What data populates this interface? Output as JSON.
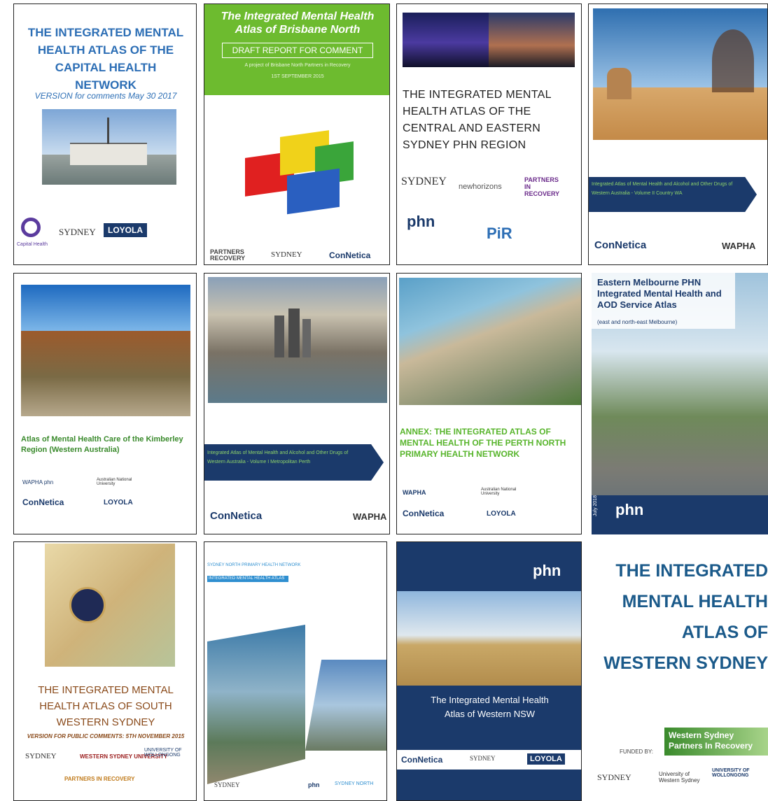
{
  "covers": [
    {
      "title": "THE INTEGRATED MENTAL HEALTH ATLAS OF THE CAPITAL HEALTH NETWORK",
      "subtitle": "VERSION for comments May 30 2017",
      "logos": [
        "Capital Health",
        "SYDNEY",
        "LOYOLA"
      ]
    },
    {
      "title": "The Integrated Mental Health Atlas of Brisbane North",
      "banner": "DRAFT REPORT FOR COMMENT",
      "subtitle": "A project of Brisbane North Partners in Recovery",
      "date": "1ST SEPTEMBER 2015",
      "logos": [
        "PARTNERS RECOVERY",
        "SYDNEY",
        "ConNetica"
      ]
    },
    {
      "title": "THE INTEGRATED MENTAL HEALTH ATLAS OF THE CENTRAL AND EASTERN SYDNEY PHN REGION",
      "logos": [
        "SYDNEY",
        "newhorizons",
        "PARTNERS IN RECOVERY",
        "phn",
        "PiR"
      ]
    },
    {
      "title": "Integrated Atlas of Mental Health and Alcohol and Other Drugs of Western Australia - Volume II Country WA",
      "logos": [
        "ConNetica",
        "WAPHA"
      ]
    },
    {
      "title": "Atlas of Mental Health Care of the Kimberley Region (Western Australia)",
      "logos": [
        "WAPHA phn",
        "Australian National University",
        "ConNetica",
        "LOYOLA"
      ]
    },
    {
      "title": "Integrated Atlas of Mental Health and Alcohol and Other Drugs of Western Australia - Volume I Metropolitan Perth",
      "logos": [
        "ConNetica",
        "WAPHA"
      ]
    },
    {
      "title": "ANNEX: THE INTEGRATED ATLAS OF MENTAL HEALTH OF THE PERTH NORTH PRIMARY HEALTH NETWORK",
      "logos": [
        "WAPHA",
        "Australian National University",
        "ConNetica",
        "LOYOLA"
      ]
    },
    {
      "title": "Eastern Melbourne PHN Integrated Mental Health and AOD Service Atlas",
      "subtitle": "(east and north-east Melbourne)",
      "date": "July 2018",
      "logos": [
        "phn"
      ]
    },
    {
      "title": "THE INTEGRATED MENTAL HEALTH ATLAS OF SOUTH WESTERN SYDNEY",
      "subtitle": "VERSION FOR PUBLIC COMMENTS: 5TH NOVEMBER 2015",
      "logos": [
        "SYDNEY",
        "WESTERN SYDNEY UNIVERSITY",
        "UNIVERSITY OF WOLLONGONG",
        "PARTNERS IN RECOVERY"
      ]
    },
    {
      "title": "SYDNEY NORTH PRIMARY HEALTH NETWORK",
      "subtitle": "INTEGRATED MENTAL HEALTH ATLAS",
      "logos": [
        "SYDNEY",
        "phn",
        "SYDNEY NORTH"
      ]
    },
    {
      "title": "The Integrated Mental Health Atlas of Western NSW",
      "logos": [
        "phn",
        "ConNetica",
        "SYDNEY",
        "LOYOLA"
      ]
    },
    {
      "title": "THE INTEGRATED MENTAL HEALTH ATLAS OF WESTERN SYDNEY",
      "funded": "FUNDED BY:",
      "funder": "Western Sydney Partners In Recovery",
      "logos": [
        "SYDNEY",
        "University of Western Sydney",
        "UNIVERSITY OF WOLLONGONG"
      ]
    }
  ],
  "colors": {
    "navy": "#1b3a6b",
    "green": "#5aac2d",
    "blue": "#2c6eb5"
  }
}
